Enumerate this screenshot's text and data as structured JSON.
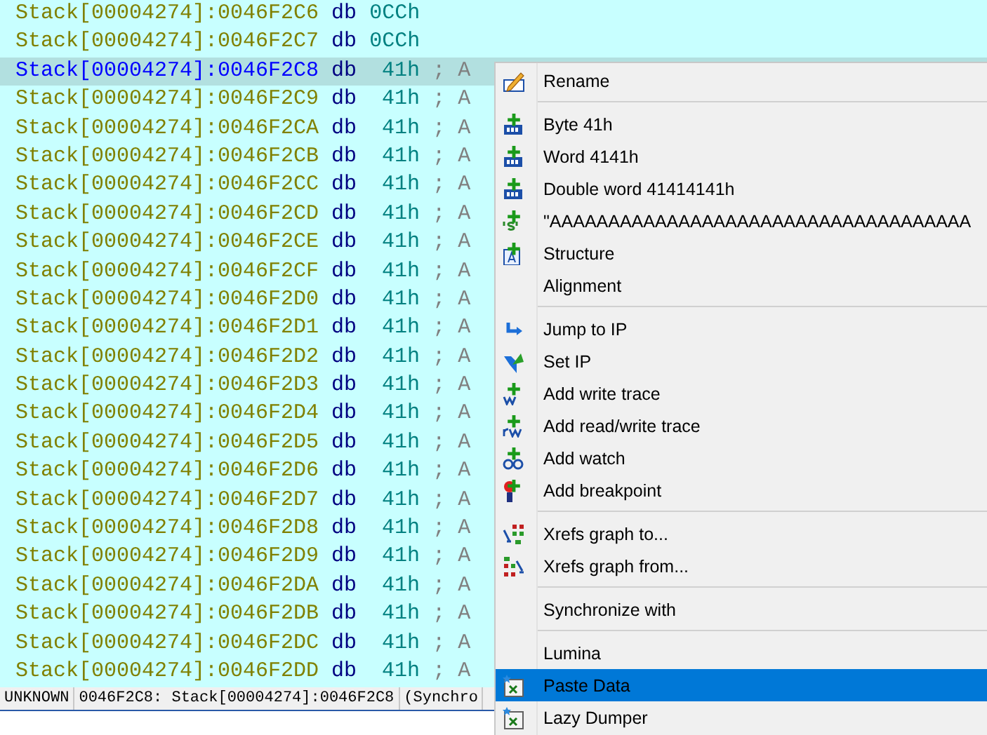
{
  "listing": {
    "rows": [
      {
        "address": "Stack[00004274]:0046F2C6",
        "mnemonic": "db",
        "operand": "0CCh",
        "comment": "",
        "selected": false
      },
      {
        "address": "Stack[00004274]:0046F2C7",
        "mnemonic": "db",
        "operand": "0CCh",
        "comment": "",
        "selected": false
      },
      {
        "address": "Stack[00004274]:0046F2C8",
        "mnemonic": "db",
        "operand": "41h",
        "comment": "; A",
        "selected": true
      },
      {
        "address": "Stack[00004274]:0046F2C9",
        "mnemonic": "db",
        "operand": "41h",
        "comment": "; A",
        "selected": false
      },
      {
        "address": "Stack[00004274]:0046F2CA",
        "mnemonic": "db",
        "operand": "41h",
        "comment": "; A",
        "selected": false
      },
      {
        "address": "Stack[00004274]:0046F2CB",
        "mnemonic": "db",
        "operand": "41h",
        "comment": "; A",
        "selected": false
      },
      {
        "address": "Stack[00004274]:0046F2CC",
        "mnemonic": "db",
        "operand": "41h",
        "comment": "; A",
        "selected": false
      },
      {
        "address": "Stack[00004274]:0046F2CD",
        "mnemonic": "db",
        "operand": "41h",
        "comment": "; A",
        "selected": false
      },
      {
        "address": "Stack[00004274]:0046F2CE",
        "mnemonic": "db",
        "operand": "41h",
        "comment": "; A",
        "selected": false
      },
      {
        "address": "Stack[00004274]:0046F2CF",
        "mnemonic": "db",
        "operand": "41h",
        "comment": "; A",
        "selected": false
      },
      {
        "address": "Stack[00004274]:0046F2D0",
        "mnemonic": "db",
        "operand": "41h",
        "comment": "; A",
        "selected": false
      },
      {
        "address": "Stack[00004274]:0046F2D1",
        "mnemonic": "db",
        "operand": "41h",
        "comment": "; A",
        "selected": false
      },
      {
        "address": "Stack[00004274]:0046F2D2",
        "mnemonic": "db",
        "operand": "41h",
        "comment": "; A",
        "selected": false
      },
      {
        "address": "Stack[00004274]:0046F2D3",
        "mnemonic": "db",
        "operand": "41h",
        "comment": "; A",
        "selected": false
      },
      {
        "address": "Stack[00004274]:0046F2D4",
        "mnemonic": "db",
        "operand": "41h",
        "comment": "; A",
        "selected": false
      },
      {
        "address": "Stack[00004274]:0046F2D5",
        "mnemonic": "db",
        "operand": "41h",
        "comment": "; A",
        "selected": false
      },
      {
        "address": "Stack[00004274]:0046F2D6",
        "mnemonic": "db",
        "operand": "41h",
        "comment": "; A",
        "selected": false
      },
      {
        "address": "Stack[00004274]:0046F2D7",
        "mnemonic": "db",
        "operand": "41h",
        "comment": "; A",
        "selected": false
      },
      {
        "address": "Stack[00004274]:0046F2D8",
        "mnemonic": "db",
        "operand": "41h",
        "comment": "; A",
        "selected": false
      },
      {
        "address": "Stack[00004274]:0046F2D9",
        "mnemonic": "db",
        "operand": "41h",
        "comment": "; A",
        "selected": false
      },
      {
        "address": "Stack[00004274]:0046F2DA",
        "mnemonic": "db",
        "operand": "41h",
        "comment": "; A",
        "selected": false
      },
      {
        "address": "Stack[00004274]:0046F2DB",
        "mnemonic": "db",
        "operand": "41h",
        "comment": "; A",
        "selected": false
      },
      {
        "address": "Stack[00004274]:0046F2DC",
        "mnemonic": "db",
        "operand": "41h",
        "comment": "; A",
        "selected": false
      },
      {
        "address": "Stack[00004274]:0046F2DD",
        "mnemonic": "db",
        "operand": "41h",
        "comment": "; A",
        "selected": false
      }
    ]
  },
  "status_bar": [
    "UNKNOWN",
    "0046F2C8: Stack[00004274]:0046F2C8",
    "(Synchro"
  ],
  "context_menu": {
    "items": [
      {
        "kind": "item",
        "label": "Rename",
        "selected": false
      },
      {
        "kind": "separator"
      },
      {
        "kind": "item",
        "label": "Byte 41h",
        "selected": false
      },
      {
        "kind": "item",
        "label": "Word 4141h",
        "selected": false
      },
      {
        "kind": "item",
        "label": "Double word 41414141h",
        "selected": false
      },
      {
        "kind": "item",
        "label": "\"AAAAAAAAAAAAAAAAAAAAAAAAAAAAAAAAAAAA",
        "selected": false
      },
      {
        "kind": "item",
        "label": "Structure",
        "selected": false
      },
      {
        "kind": "item",
        "label": "Alignment",
        "selected": false
      },
      {
        "kind": "separator"
      },
      {
        "kind": "item",
        "label": "Jump to IP",
        "selected": false
      },
      {
        "kind": "item",
        "label": "Set IP",
        "selected": false
      },
      {
        "kind": "item",
        "label": "Add write trace",
        "selected": false
      },
      {
        "kind": "item",
        "label": "Add read/write trace",
        "selected": false
      },
      {
        "kind": "item",
        "label": "Add watch",
        "selected": false
      },
      {
        "kind": "item",
        "label": "Add breakpoint",
        "selected": false
      },
      {
        "kind": "separator"
      },
      {
        "kind": "item",
        "label": "Xrefs graph to...",
        "selected": false
      },
      {
        "kind": "item",
        "label": "Xrefs graph from...",
        "selected": false
      },
      {
        "kind": "separator"
      },
      {
        "kind": "item",
        "label": "Synchronize with",
        "selected": false
      },
      {
        "kind": "separator"
      },
      {
        "kind": "item",
        "label": "Lumina",
        "selected": false
      },
      {
        "kind": "item",
        "label": "Paste Data",
        "selected": true
      },
      {
        "kind": "item",
        "label": "Lazy Dumper",
        "selected": false
      }
    ]
  }
}
